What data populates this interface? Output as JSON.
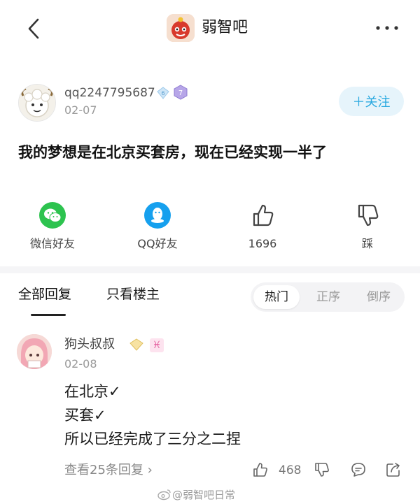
{
  "header": {
    "forum_name": "弱智吧",
    "back_icon": "chevron-left-icon",
    "more_icon": "more-dots-icon"
  },
  "post": {
    "author": "qq2247795687",
    "level_badge": "6",
    "rank_badge": "7",
    "date": "02-07",
    "follow_label": "＋关注",
    "title": "我的梦想是在北京买套房，现在已经实现一半了"
  },
  "share": [
    {
      "label": "微信好友",
      "icon": "wechat-icon"
    },
    {
      "label": "QQ好友",
      "icon": "qq-icon"
    },
    {
      "label": "1696",
      "icon": "thumbs-up-icon"
    },
    {
      "label": "踩",
      "icon": "thumbs-down-icon"
    }
  ],
  "tabs": {
    "all_replies": "全部回复",
    "op_only": "只看楼主"
  },
  "sort": {
    "hot": "热门",
    "ascending": "正序",
    "descending": "倒序"
  },
  "reply": {
    "author": "狗头叔叔",
    "zodiac": "♓",
    "date": "02-08",
    "lines": [
      "在北京✓",
      "买套✓",
      "所以已经完成了三分之二捏"
    ],
    "view_replies": "查看25条回复 ›",
    "like_count": "468"
  },
  "watermark": "@弱智吧日常",
  "colors": {
    "accent": "#2aa9e0",
    "follow_bg": "#e6f4fb",
    "wechat": "#2dc34f",
    "qq": "#16a0ee"
  }
}
